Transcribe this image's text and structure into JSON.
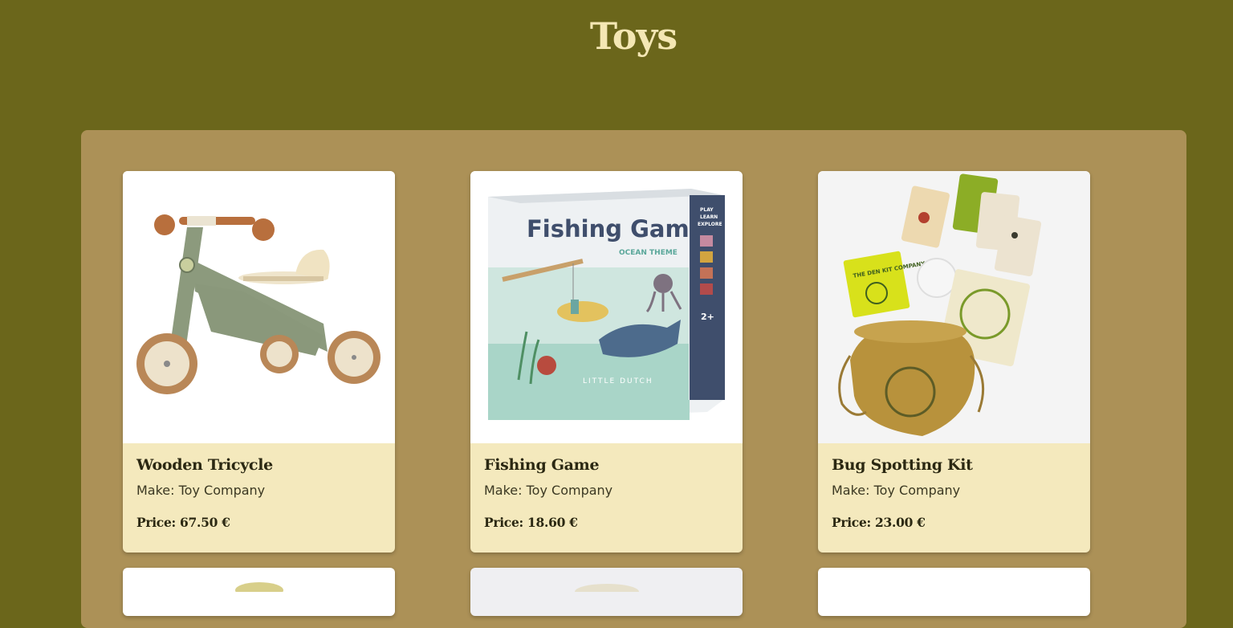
{
  "page": {
    "title": "Toys"
  },
  "products": [
    {
      "name": "Wooden Tricycle",
      "make_label": "Make: Toy Company",
      "price_label": "Price:",
      "price_value": "67.50 €",
      "image_icon": "tricycle-image"
    },
    {
      "name": "Fishing Game",
      "make_label": "Make: Toy Company",
      "price_label": "Price:",
      "price_value": "18.60 €",
      "image_icon": "fishing-game-image",
      "box_text": {
        "title": "Fishing Game",
        "subtitle": "OCEAN THEME",
        "side": [
          "PLAY",
          "LEARN",
          "EXPLORE"
        ],
        "age": "2+",
        "brand": "LITTLE DUTCH"
      }
    },
    {
      "name": "Bug Spotting Kit",
      "make_label": "Make: Toy Company",
      "price_label": "Price:",
      "price_value": "23.00 €",
      "image_icon": "bug-kit-image",
      "box_text": {
        "card": "THE DEN KIT COMPANY"
      }
    }
  ],
  "colors": {
    "background": "#6b661b",
    "panel": "#ac9157",
    "card_info": "#f4e9bd",
    "title": "#f4e7b4"
  }
}
